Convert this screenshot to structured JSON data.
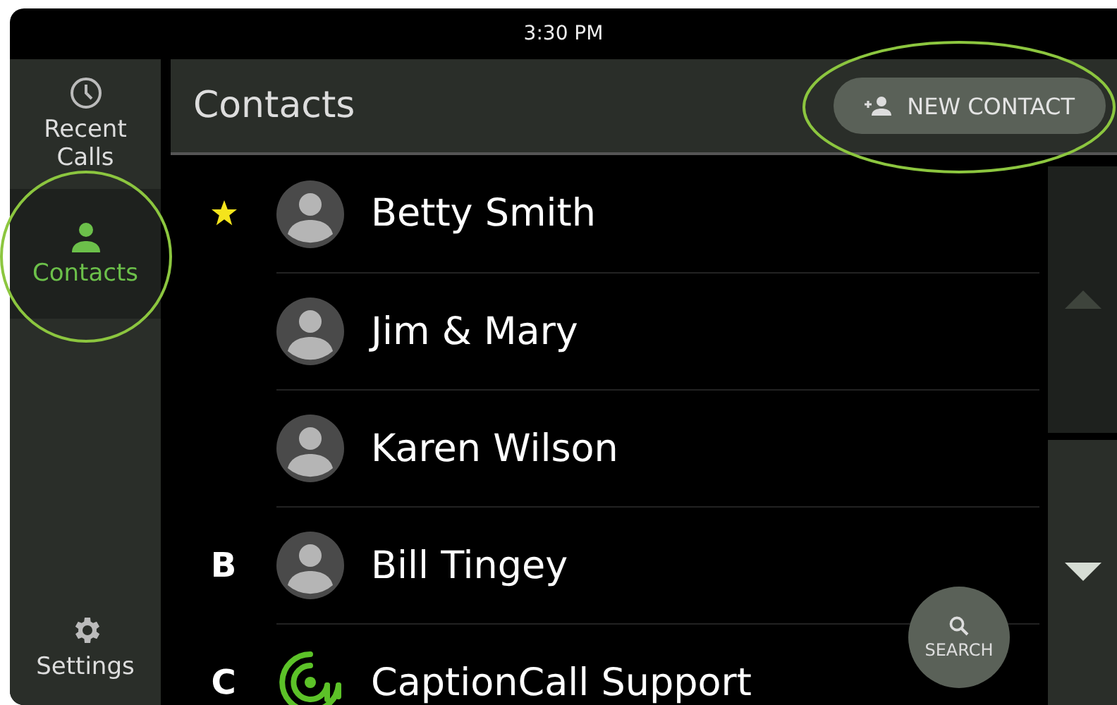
{
  "status_bar": {
    "time": "3:30 PM"
  },
  "sidebar": {
    "items": [
      {
        "kind": "clock",
        "label": "Recent Calls",
        "selected": false
      },
      {
        "kind": "person",
        "label": "Contacts",
        "selected": true
      },
      {
        "kind": "gear",
        "label": "Settings",
        "selected": false
      }
    ]
  },
  "header": {
    "title": "Contacts",
    "new_button": "NEW CONTACT"
  },
  "contacts": [
    {
      "favorite": true,
      "kind": "person",
      "name": "Betty Smith"
    },
    {
      "favorite": false,
      "kind": "person",
      "name": "Jim & Mary"
    },
    {
      "favorite": false,
      "kind": "person",
      "name": "Karen Wilson"
    },
    {
      "section": "B",
      "favorite": false,
      "kind": "person",
      "name": "Bill Tingey"
    },
    {
      "section": "C",
      "favorite": false,
      "kind": "logo",
      "name": "CaptionCall Support"
    }
  ],
  "search_button": "SEARCH"
}
